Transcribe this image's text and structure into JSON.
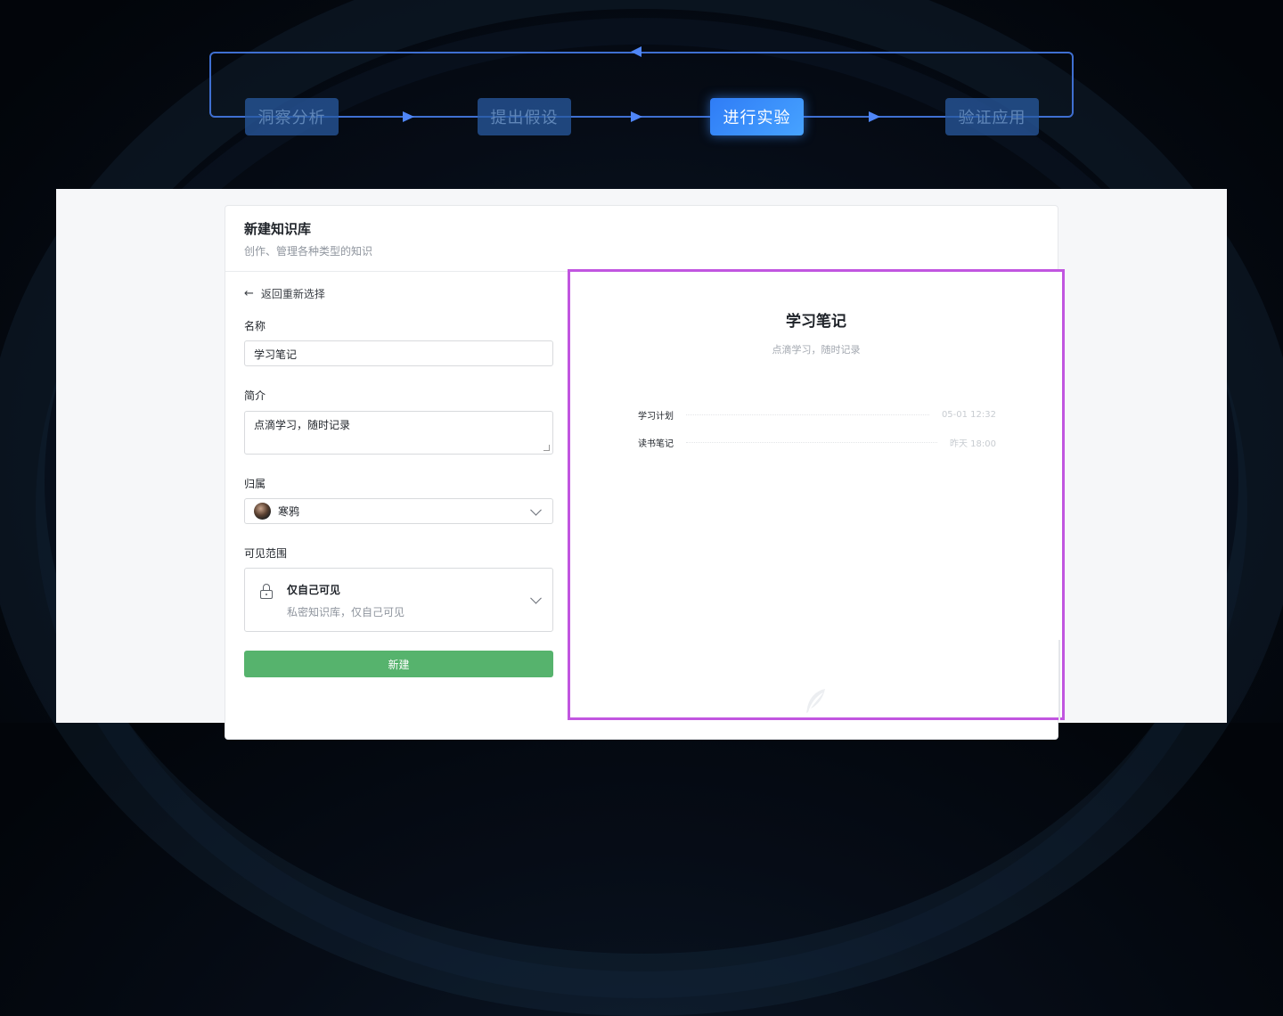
{
  "workflow": {
    "steps": [
      {
        "label": "洞察分析",
        "active": false
      },
      {
        "label": "提出假设",
        "active": false
      },
      {
        "label": "进行实验",
        "active": true
      },
      {
        "label": "验证应用",
        "active": false
      }
    ]
  },
  "card": {
    "title": "新建知识库",
    "subtitle": "创作、管理各种类型的知识"
  },
  "form": {
    "back_label": "返回重新选择",
    "name_label": "名称",
    "name_value": "学习笔记",
    "intro_label": "简介",
    "intro_value": "点滴学习，随时记录",
    "owner_label": "归属",
    "owner_value": "寒鸦",
    "visibility_label": "可见范围",
    "visibility_title": "仅自己可见",
    "visibility_desc": "私密知识库，仅自己可见",
    "submit_label": "新建"
  },
  "preview": {
    "title": "学习笔记",
    "subtitle": "点滴学习，随时记录",
    "docs": [
      {
        "name": "学习计划",
        "time": "05-01 12:32"
      },
      {
        "name": "读书笔记",
        "time": "昨天 18:00"
      }
    ]
  },
  "colors": {
    "accent_blue": "#2f7cf6",
    "submit_green": "#56b36d",
    "highlight_border": "#c156e0"
  },
  "icons": [
    "arrow-left-icon",
    "avatar",
    "lock-icon",
    "chevron-down-icon",
    "feather-icon"
  ]
}
